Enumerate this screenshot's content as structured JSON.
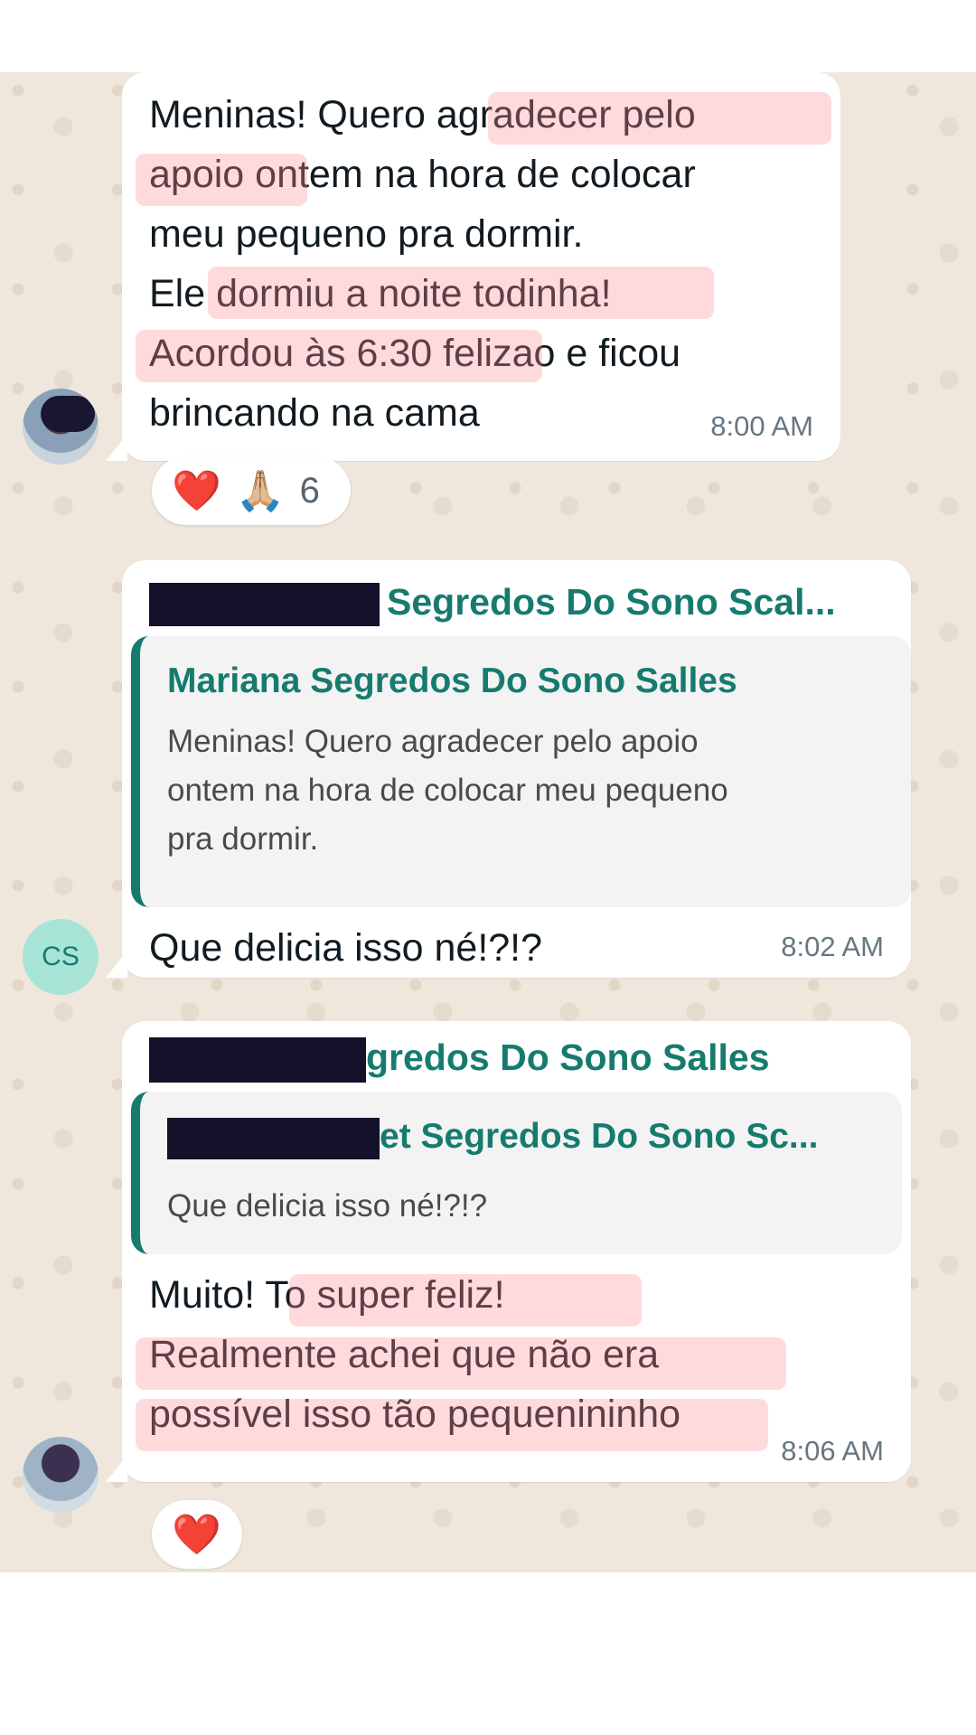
{
  "messages": [
    {
      "lines": [
        "Meninas! Quero agradecer pelo",
        "apoio ontem na hora de colocar",
        "meu pequeno pra dormir.",
        "Ele dormiu a noite todinha!",
        "Acordou às 6:30 felizao e ficou",
        "brincando na cama"
      ],
      "time": "8:00 AM",
      "reactions": {
        "emojis": [
          "❤️",
          "🙏🏼"
        ],
        "count": "6"
      }
    },
    {
      "sender": "Segredos Do Sono Scal...",
      "quote": {
        "sender": "Mariana Segredos Do Sono Salles",
        "lines": [
          "Meninas! Quero agradecer pelo apoio",
          "ontem na hora de colocar meu pequeno",
          "pra dormir."
        ]
      },
      "text": "Que delicia isso né!?!?",
      "time": "8:02 AM",
      "avatar_initials": "CS"
    },
    {
      "sender": "gredos Do Sono Salles",
      "quote": {
        "sender": "et Segredos Do Sono Sc...",
        "lines": [
          "Que delicia isso né!?!?"
        ]
      },
      "lines": [
        "Muito! To super feliz!",
        "Realmente achei que não era",
        "possível isso tão pequenininho"
      ],
      "time": "8:06 AM",
      "reactions": {
        "emojis": [
          "❤️"
        ]
      }
    }
  ],
  "colors": {
    "accent": "#167b6f",
    "chat_bg": "#efe7dc",
    "avatar_cs_bg": "#a8e4d6"
  }
}
